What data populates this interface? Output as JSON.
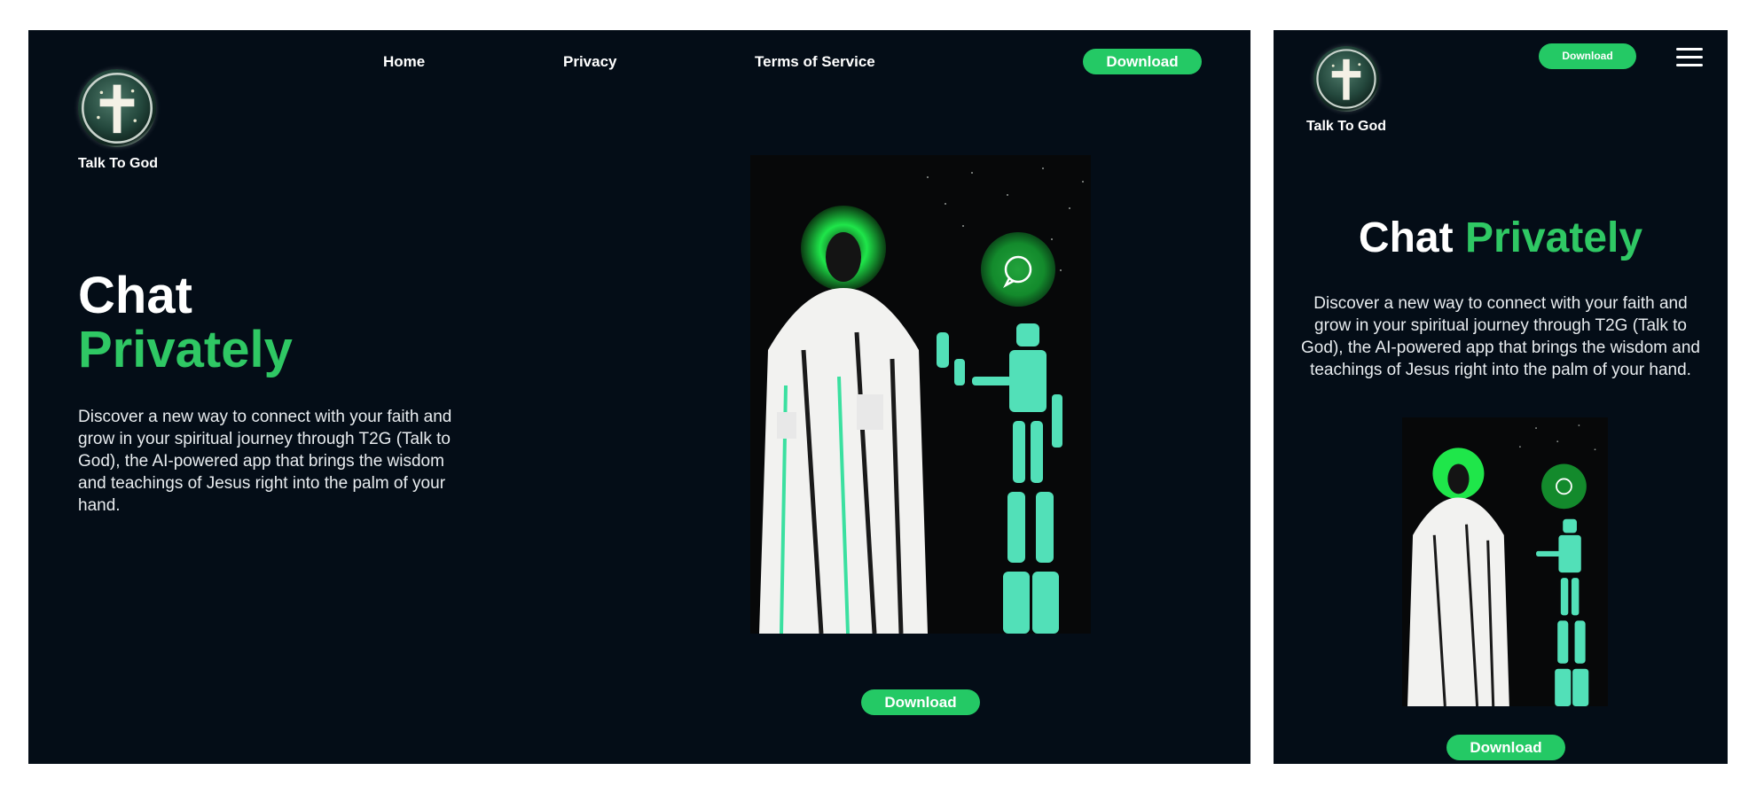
{
  "brand": {
    "name": "Talk To God",
    "logo_icon": "cross-medallion-icon"
  },
  "nav": {
    "items": [
      "Home",
      "Privacy",
      "Terms of Service"
    ],
    "download_label": "Download"
  },
  "hero": {
    "title_part1": "Chat",
    "title_part2": "Privately",
    "description": "Discover a new way to connect with your faith and grow in your spiritual journey through T2G (Talk to God), the AI-powered app that brings the wisdom and teachings of Jesus right into the palm of your hand.",
    "image_icon": "jesus-and-robot-illustration",
    "chat_icon": "chat-bubble-icon"
  },
  "cta": {
    "download_label": "Download"
  },
  "mobile": {
    "menu_icon": "hamburger-menu-icon",
    "header_download_label": "Download"
  },
  "colors": {
    "background": "#040d17",
    "accent": "#24c965",
    "page": "#ffffff"
  }
}
